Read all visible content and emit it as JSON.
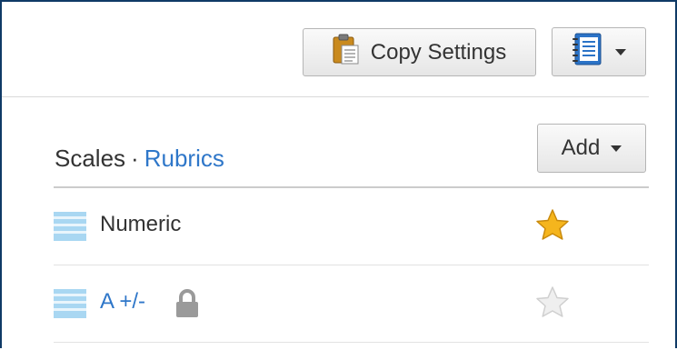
{
  "toolbar": {
    "copy_settings_label": "Copy Settings",
    "clipboard_icon": "clipboard-icon",
    "view_icon": "notebook-icon"
  },
  "section": {
    "title": "Scales",
    "separator": "·",
    "alt_link": "Rubrics",
    "add_label": "Add"
  },
  "scales": [
    {
      "name": "Numeric",
      "starred": true,
      "locked": false
    },
    {
      "name": "A +/-",
      "starred": false,
      "locked": true
    }
  ],
  "colors": {
    "link": "#2f77c9",
    "star_active": "#f5b51d",
    "star_inactive": "#e6e6e6"
  }
}
